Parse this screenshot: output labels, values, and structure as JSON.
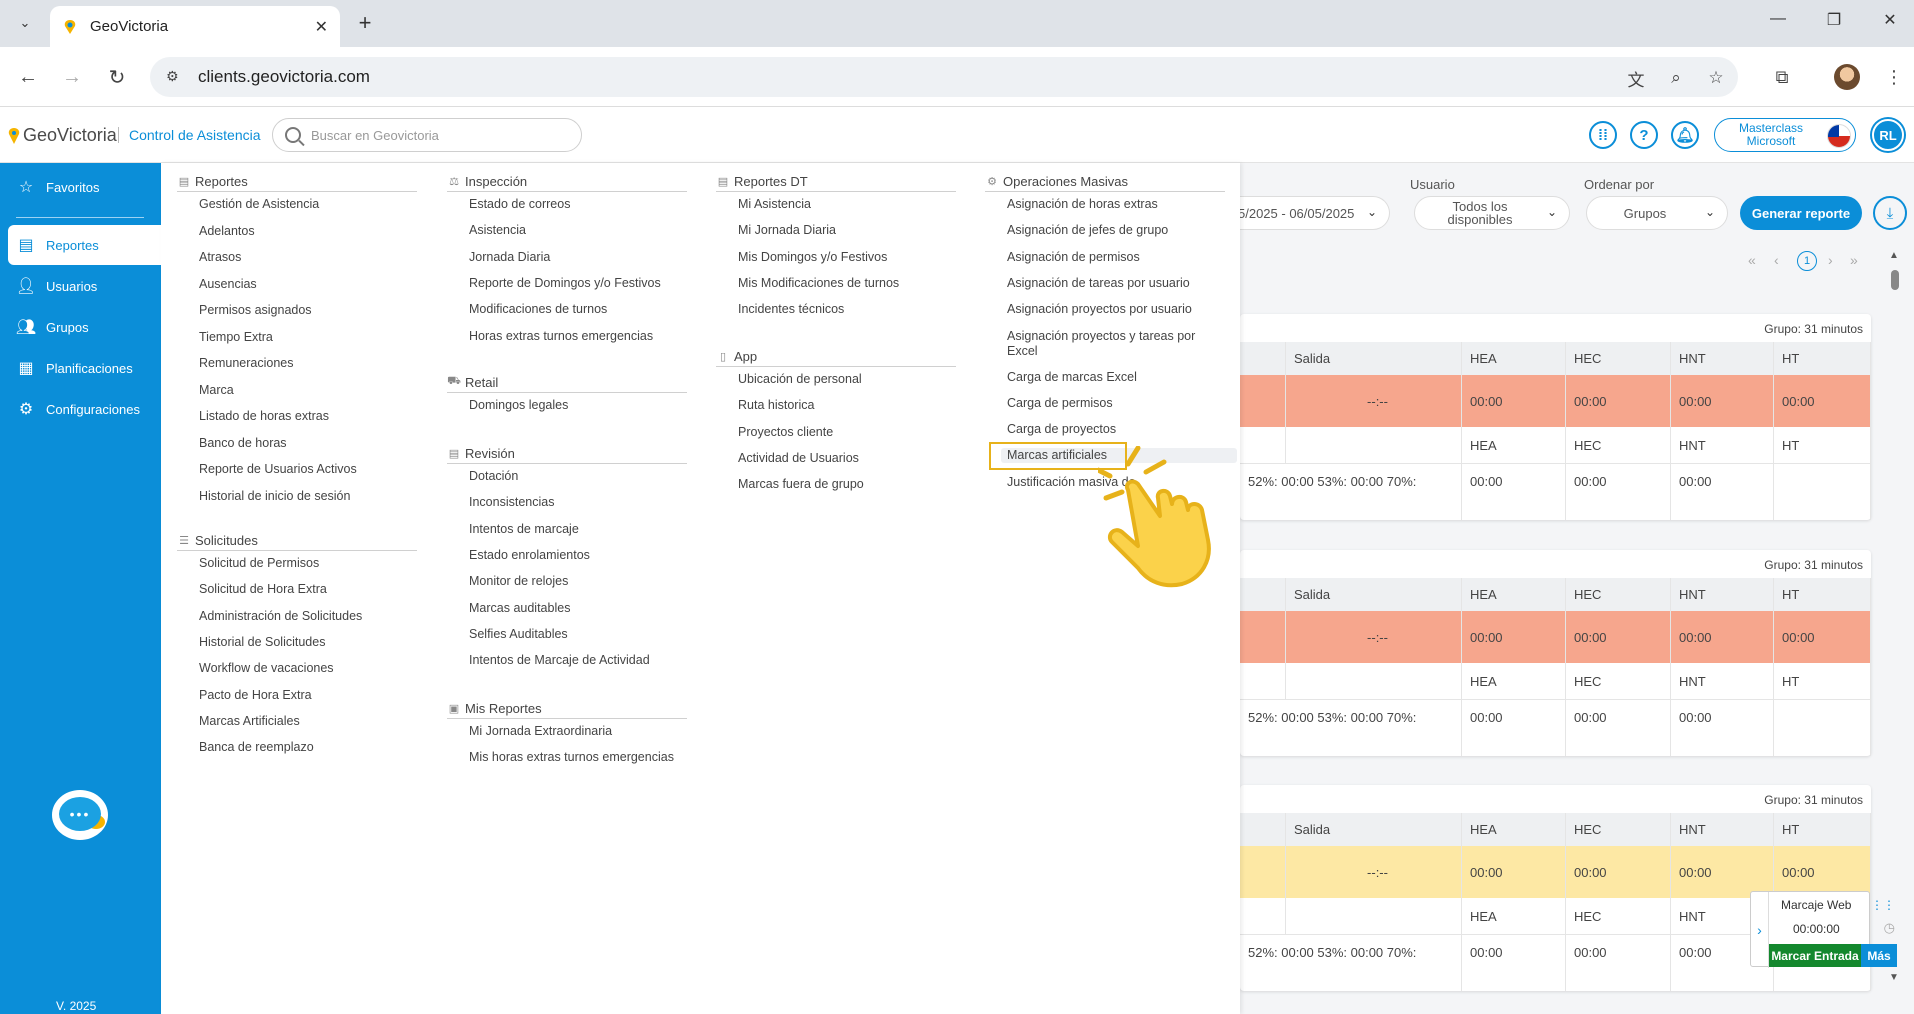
{
  "browser": {
    "tab_title": "GeoVictoria",
    "url": "clients.geovictoria.com"
  },
  "header": {
    "logo_text": "GeoVictoria",
    "module": "Control de Asistencia",
    "search_placeholder": "Buscar en Geovictoria",
    "masterclass_line1": "Masterclass",
    "masterclass_line2": "Microsoft",
    "avatar_initials": "RL",
    "help_glyph": "?"
  },
  "sidebar": {
    "items": [
      {
        "label": "Favoritos",
        "icon": "star-icon"
      },
      {
        "label": "Reportes",
        "icon": "document-icon"
      },
      {
        "label": "Usuarios",
        "icon": "user-icon"
      },
      {
        "label": "Grupos",
        "icon": "group-icon"
      },
      {
        "label": "Planificaciones",
        "icon": "calendar-icon"
      },
      {
        "label": "Configuraciones",
        "icon": "gear-icon"
      }
    ],
    "version": "V. 2025"
  },
  "filters": {
    "date_range": "5/2025 - 06/05/2025",
    "usuario_label": "Usuario",
    "usuario_line1": "Todos los",
    "usuario_line2": "disponibles",
    "ordenar_label": "Ordenar por",
    "ordenar_value": "Grupos",
    "generate_label": "Generar reporte",
    "current_page": "1"
  },
  "table": {
    "group_label": "Grupo: 31 minutos",
    "col_salida": "Salida",
    "col_hea": "HEA",
    "col_hec": "HEC",
    "col_hnt": "HNT",
    "col_ht": "HT",
    "time_zero": "00:00",
    "empty_time": "--:--",
    "percent_text": "52%: 00:00 53%: 00:00 70%:"
  },
  "marcaje": {
    "title": "Marcaje Web",
    "time": "00:00:00",
    "entrada_label": "Marcar Entrada",
    "mas_label": "Más"
  },
  "menu": {
    "reportes": {
      "title": "Reportes",
      "items": [
        "Gestión de Asistencia",
        "Adelantos",
        "Atrasos",
        "Ausencias",
        "Permisos asignados",
        "Tiempo Extra",
        "Remuneraciones",
        "Marca",
        "Listado de horas extras",
        "Banco de horas",
        "Reporte de Usuarios Activos",
        "Historial de inicio de sesión"
      ]
    },
    "solicitudes": {
      "title": "Solicitudes",
      "items": [
        "Solicitud de Permisos",
        "Solicitud de Hora Extra",
        "Administración de Solicitudes",
        "Historial de Solicitudes",
        "Workflow de vacaciones",
        "Pacto de Hora Extra",
        "Marcas Artificiales",
        "Banca de reemplazo"
      ]
    },
    "inspeccion": {
      "title": "Inspección",
      "items": [
        "Estado de correos",
        "Asistencia",
        "Jornada Diaria",
        "Reporte de Domingos y/o Festivos",
        "Modificaciones de turnos",
        "Horas extras turnos emergencias"
      ]
    },
    "retail": {
      "title": "Retail",
      "items": [
        "Domingos legales"
      ]
    },
    "revision": {
      "title": "Revisión",
      "items": [
        "Dotación",
        "Inconsistencias",
        "Intentos de marcaje",
        "Estado enrolamientos",
        "Monitor de relojes",
        "Marcas auditables",
        "Selfies Auditables",
        "Intentos de Marcaje de Actividad"
      ]
    },
    "mis_reportes": {
      "title": "Mis Reportes",
      "items": [
        "Mi Jornada Extraordinaria",
        "Mis horas extras turnos emergencias"
      ]
    },
    "reportes_dt": {
      "title": "Reportes DT",
      "items": [
        "Mi Asistencia",
        "Mi Jornada Diaria",
        "Mis Domingos y/o Festivos",
        "Mis Modificaciones de turnos",
        "Incidentes técnicos"
      ]
    },
    "app": {
      "title": "App",
      "items": [
        "Ubicación de personal",
        "Ruta historica",
        "Proyectos cliente",
        "Actividad de Usuarios",
        "Marcas fuera de grupo"
      ]
    },
    "operaciones": {
      "title": "Operaciones Masivas",
      "items": [
        "Asignación de horas extras",
        "Asignación de jefes de grupo",
        "Asignación de permisos",
        "Asignación de tareas por usuario",
        "Asignación proyectos por usuario",
        "Asignación proyectos y tareas por Excel",
        "Carga de marcas Excel",
        "Carga de permisos",
        "Carga de proyectos",
        "Marcas artificiales",
        "Justificación masiva de"
      ]
    }
  },
  "colors": {
    "brand": "#0b8ed8",
    "salmon_row": "#f6a68d",
    "yellow_row": "#fde8a4",
    "highlight_box": "#e7b21a",
    "green_button": "#14882e"
  }
}
